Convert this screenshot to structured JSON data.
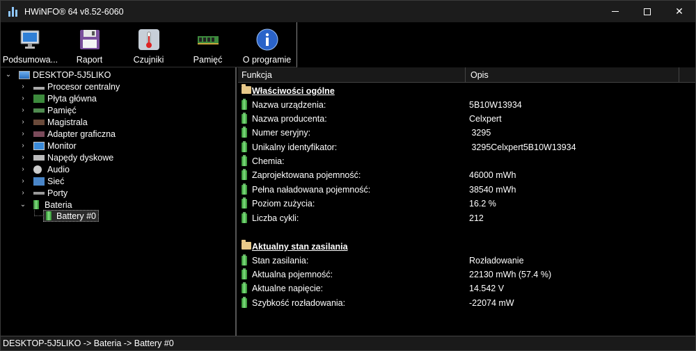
{
  "window": {
    "title": "HWiNFO® 64 v8.52-6060",
    "controls": {
      "minimize": "minimize-icon",
      "maximize": "maximize-icon",
      "close": "close-icon"
    }
  },
  "toolbar": {
    "buttons": [
      {
        "label": "Podsumowa...",
        "icon": "monitor-icon"
      },
      {
        "label": "Raport",
        "icon": "floppy-disk-icon"
      },
      {
        "label": "Czujniki",
        "icon": "thermometer-icon"
      },
      {
        "label": "Pamięć",
        "icon": "memory-module-icon"
      },
      {
        "label": "O programie",
        "icon": "info-icon"
      }
    ]
  },
  "tree": {
    "root": "DESKTOP-5J5LIKO",
    "items": [
      {
        "label": "Procesor centralny",
        "icon": "cpu-icon"
      },
      {
        "label": "Płyta główna",
        "icon": "motherboard-icon"
      },
      {
        "label": "Pamięć",
        "icon": "memory-icon"
      },
      {
        "label": "Magistrala",
        "icon": "bus-icon"
      },
      {
        "label": "Adapter graficzna",
        "icon": "gpu-icon"
      },
      {
        "label": "Monitor",
        "icon": "monitor-icon"
      },
      {
        "label": "Napędy dyskowe",
        "icon": "drive-icon"
      },
      {
        "label": "Audio",
        "icon": "audio-icon"
      },
      {
        "label": "Sieć",
        "icon": "network-icon"
      },
      {
        "label": "Porty",
        "icon": "port-icon"
      },
      {
        "label": "Bateria",
        "icon": "battery-icon"
      }
    ],
    "child": "Battery #0"
  },
  "panel": {
    "headers": {
      "col1": "Funkcja",
      "col2": "Opis"
    },
    "sections": [
      {
        "title": "Właściwości ogólne",
        "rows": [
          {
            "key": "Nazwa urządzenia:",
            "value": "5B10W13934"
          },
          {
            "key": "Nazwa producenta:",
            "value": "Celxpert"
          },
          {
            "key": "Numer seryjny:",
            "value": " 3295"
          },
          {
            "key": "Unikalny identyfikator:",
            "value": " 3295Celxpert5B10W13934"
          },
          {
            "key": "Chemia:",
            "value": ""
          },
          {
            "key": "Zaprojektowana pojemność:",
            "value": "46000 mWh"
          },
          {
            "key": "Pełna naładowana pojemność:",
            "value": "38540 mWh"
          },
          {
            "key": "Poziom zużycia:",
            "value": "16.2 %"
          },
          {
            "key": "Liczba cykli:",
            "value": "212"
          }
        ]
      },
      {
        "title": "Aktualny stan zasilania",
        "rows": [
          {
            "key": "Stan zasilania:",
            "value": "Rozładowanie"
          },
          {
            "key": "Aktualna pojemność:",
            "value": "22130 mWh (57.4 %)"
          },
          {
            "key": "Aktualne napięcie:",
            "value": "14.542 V"
          },
          {
            "key": "Szybkość rozładowania:",
            "value": "-22074 mW"
          }
        ]
      }
    ]
  },
  "statusbar": {
    "path": "DESKTOP-5J5LIKO -> Bateria -> Battery #0"
  }
}
